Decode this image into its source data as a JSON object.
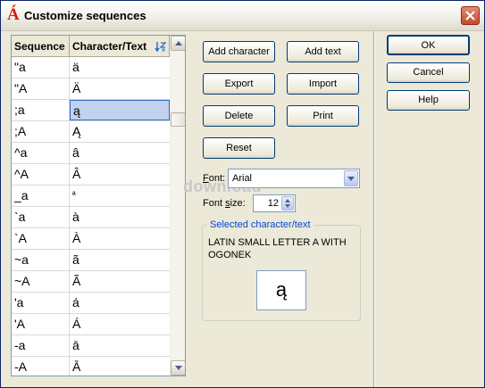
{
  "window": {
    "title": "Customize sequences",
    "icon_glyph": "Á"
  },
  "grid": {
    "headers": {
      "sequence": "Sequence",
      "character": "Character/Text"
    },
    "rows": [
      {
        "seq": "\"a",
        "chr": "ä"
      },
      {
        "seq": "\"A",
        "chr": "Ä"
      },
      {
        "seq": ";a",
        "chr": "ą"
      },
      {
        "seq": ";A",
        "chr": "Ą"
      },
      {
        "seq": "^a",
        "chr": "â"
      },
      {
        "seq": "^A",
        "chr": "Â"
      },
      {
        "seq": "_a",
        "chr": "ª"
      },
      {
        "seq": "`a",
        "chr": "à"
      },
      {
        "seq": "`A",
        "chr": "À"
      },
      {
        "seq": "~a",
        "chr": "ã"
      },
      {
        "seq": "~A",
        "chr": "Ã"
      },
      {
        "seq": "'a",
        "chr": "á"
      },
      {
        "seq": "'A",
        "chr": "Á"
      },
      {
        "seq": "-a",
        "chr": "ā"
      },
      {
        "seq": "-A",
        "chr": "Ā"
      }
    ],
    "selected_row": 2
  },
  "buttons": {
    "add_character": "Add character",
    "add_text": "Add text",
    "export": "Export",
    "import": "Import",
    "delete": "Delete",
    "print": "Print",
    "reset": "Reset",
    "ok": "OK",
    "cancel": "Cancel",
    "help": "Help"
  },
  "font": {
    "label_hotkey": "F",
    "label_rest": "ont:",
    "value": "Arial"
  },
  "font_size": {
    "label_start": "Font ",
    "label_hotkey": "s",
    "label_rest": "ize:",
    "value": "12"
  },
  "selected": {
    "group_title": "Selected character/text",
    "description": "LATIN SMALL LETTER A WITH OGONEK",
    "preview": "ą"
  },
  "watermark": "download",
  "colors": {
    "accent": "#0046d5",
    "selection": "#c1d2ee",
    "close": "#c44a2c"
  }
}
